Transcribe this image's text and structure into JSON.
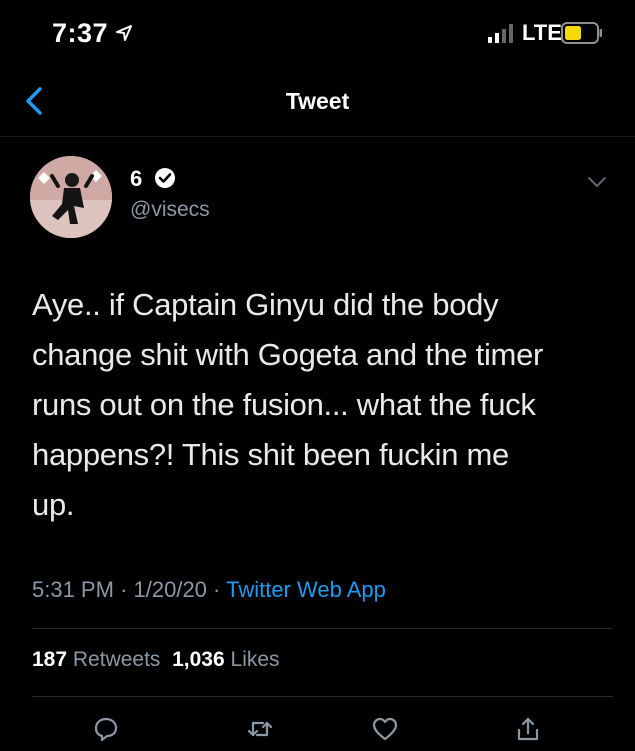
{
  "status_bar": {
    "time": "7:37",
    "network": "LTE",
    "icons": [
      "location-icon",
      "signal-icon",
      "battery-icon"
    ]
  },
  "nav": {
    "title": "Tweet",
    "back_icon": "chevron-left-icon"
  },
  "tweet": {
    "author": {
      "display_name": "6",
      "username": "@visecs",
      "verified": true
    },
    "text_lines": [
      "Aye.. if Captain Ginyu did the body",
      "change shit with Gogeta and the timer",
      "runs out on the fusion... what the fuck",
      "happens?! This shit been fuckin me",
      "up."
    ],
    "time": "5:31 PM",
    "separator": "·",
    "date": "1/20/20",
    "source": "Twitter Web App",
    "retweets_count": "187",
    "retweets_label": "Retweets",
    "likes_count": "1,036",
    "likes_label": "Likes"
  },
  "actions": [
    "reply-icon",
    "retweet-icon",
    "like-icon",
    "share-icon"
  ],
  "colors": {
    "background": "#000000",
    "accent": "#1d9bf0",
    "secondary_text": "#8b98a5",
    "battery": "#f5d90a"
  }
}
